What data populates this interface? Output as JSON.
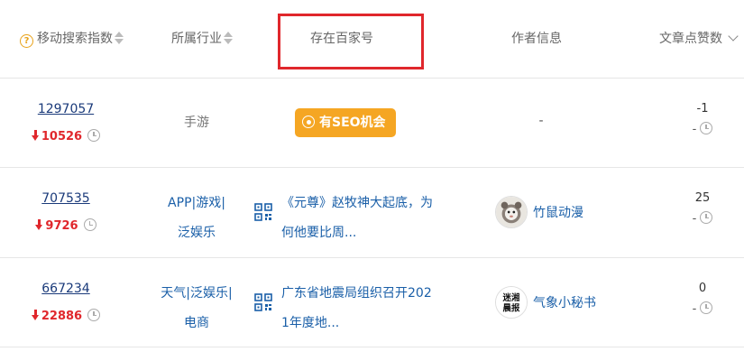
{
  "header": {
    "col_index": "移动搜索指数",
    "col_industry": "所属行业",
    "col_baijia": "存在百家号",
    "col_author": "作者信息",
    "col_likes": "文章点赞数"
  },
  "rows": [
    {
      "index_value": "1297057",
      "index_change": "10526",
      "industry_lines": [
        "手游"
      ],
      "baijia_type": "badge",
      "baijia_badge": "有SEO机会",
      "author_name": "-",
      "likes": "-1",
      "likes_change": "-"
    },
    {
      "index_value": "707535",
      "index_change": "9726",
      "industry_lines": [
        "APP|游戏|",
        "泛娱乐"
      ],
      "baijia_type": "article",
      "article_lines": [
        "《元尊》赵牧神大起底，为",
        "何他要比周..."
      ],
      "author_name": "竹鼠动漫",
      "likes": "25",
      "likes_change": "-"
    },
    {
      "index_value": "667234",
      "index_change": "22886",
      "industry_lines": [
        "天气|泛娱乐|",
        "电商"
      ],
      "baijia_type": "article",
      "article_lines": [
        "广东省地震局组织召开202",
        "1年度地..."
      ],
      "author_name": "气象小秘书",
      "avatar_text": [
        "迷湘",
        "晨报"
      ],
      "likes": "0",
      "likes_change": "-"
    }
  ],
  "colors": {
    "accent_red": "#e0272c",
    "link_blue": "#1a5fa8",
    "badge_orange": "#f5a623",
    "index_navy": "#1a3a7a"
  }
}
